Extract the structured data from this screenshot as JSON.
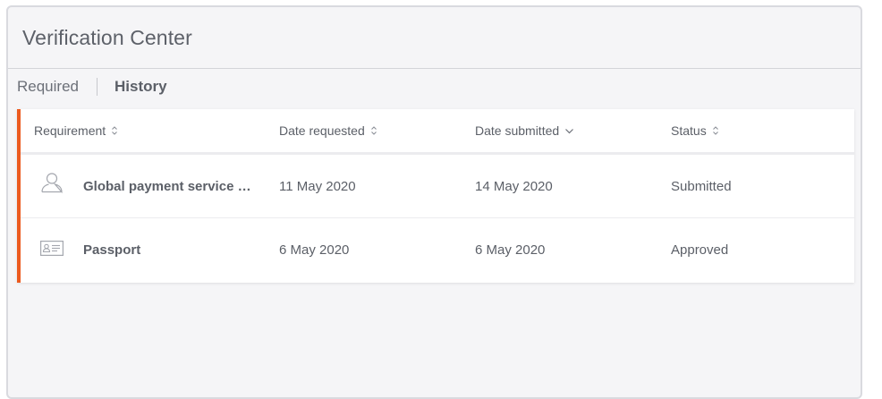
{
  "title": "Verification Center",
  "tabs": [
    {
      "label": "Required",
      "active": false
    },
    {
      "label": "History",
      "active": true
    }
  ],
  "table": {
    "columns": [
      {
        "label": "Requirement",
        "sort": "unsorted"
      },
      {
        "label": "Date requested",
        "sort": "unsorted"
      },
      {
        "label": "Date submitted",
        "sort": "descending"
      },
      {
        "label": "Status",
        "sort": "unsorted"
      }
    ],
    "rows": [
      {
        "icon": "person-outline-icon",
        "requirement": "Global payment service qu…",
        "date_requested": "11 May 2020",
        "date_submitted": "14 May 2020",
        "status": "Submitted"
      },
      {
        "icon": "id-card-icon",
        "requirement": "Passport",
        "date_requested": "6 May 2020",
        "date_submitted": "6 May 2020",
        "status": "Approved"
      }
    ]
  },
  "colors": {
    "accent": "#ec5a1e",
    "text": "#5b5f67",
    "panel_bg": "#f5f5f7"
  }
}
